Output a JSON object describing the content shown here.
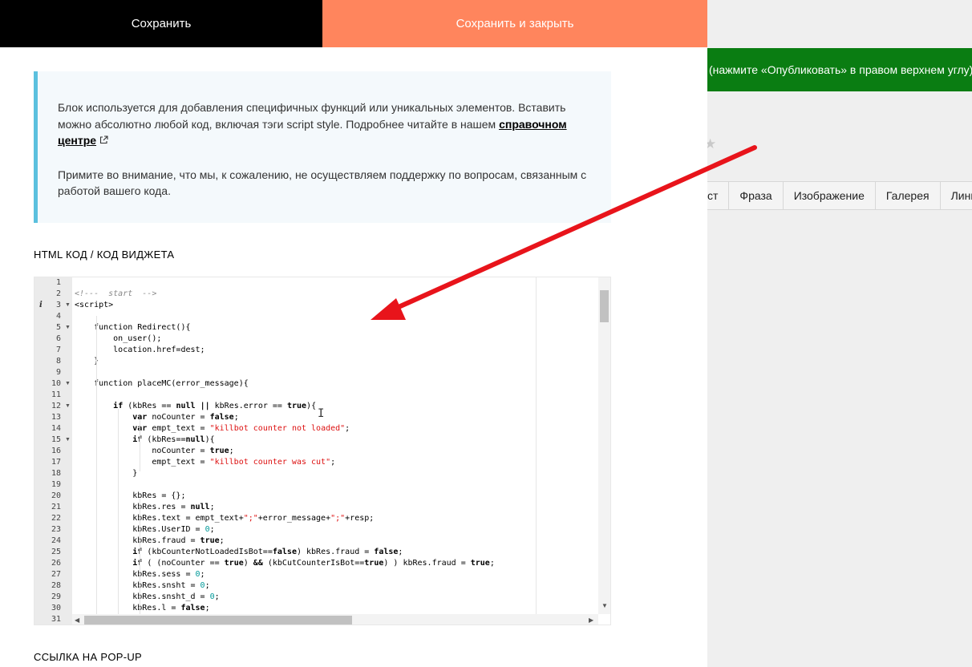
{
  "buttons": {
    "save": "Сохранить",
    "save_close": "Сохранить и закрыть"
  },
  "background": {
    "banner": "(нажмите «Опубликовать» в правом верхнем углу)",
    "toolbar": [
      "ст",
      "Фраза",
      "Изображение",
      "Галерея",
      "Линия"
    ]
  },
  "info": {
    "p1_text": "Блок используется для добавления специфичных функций или уникальных элементов. Вставить можно абсолютно любой код, включая тэги script style. Подробнее читайте в нашем ",
    "p1_link": "справочном центре",
    "p2": "Примите во внимание, что мы, к сожалению, не осуществляем поддержку по вопросам, связанным с работой вашего кода."
  },
  "section_html_title": "HTML КОД / КОД ВИДЖЕТА",
  "section_popup_title": "ССЫЛКА НА POP-UP",
  "colors": {
    "save": "#000000",
    "save_close": "#ff855d",
    "banner": "#0a7d12",
    "info_border": "#5bc0de",
    "arrow": "#e8141b"
  },
  "code_lines": [
    [],
    [
      [
        "c",
        "<!---  start  -->"
      ]
    ],
    [
      [
        "p",
        "<script>"
      ]
    ],
    [],
    [
      [
        "p",
        "    function Redirect(){"
      ]
    ],
    [
      [
        "p",
        "        on_user();"
      ]
    ],
    [
      [
        "p",
        "        location.href=dest;"
      ]
    ],
    [
      [
        "p",
        "    }"
      ]
    ],
    [],
    [
      [
        "p",
        "    function placeMC(error_message){"
      ]
    ],
    [],
    [
      [
        "p",
        "        "
      ],
      [
        "k",
        "if"
      ],
      [
        "p",
        " (kbRes == "
      ],
      [
        "k",
        "null"
      ],
      [
        "p",
        " "
      ],
      [
        "k",
        "||"
      ],
      [
        "p",
        " kbRes.error == "
      ],
      [
        "k",
        "true"
      ],
      [
        "p",
        "){"
      ]
    ],
    [
      [
        "p",
        "            "
      ],
      [
        "k",
        "var"
      ],
      [
        "p",
        " noCounter = "
      ],
      [
        "k",
        "false"
      ],
      [
        "p",
        ";"
      ]
    ],
    [
      [
        "p",
        "            "
      ],
      [
        "k",
        "var"
      ],
      [
        "p",
        " empt_text = "
      ],
      [
        "s",
        "\"killbot counter not loaded\""
      ],
      [
        "p",
        ";"
      ]
    ],
    [
      [
        "p",
        "            "
      ],
      [
        "k",
        "if"
      ],
      [
        "p",
        " (kbRes=="
      ],
      [
        "k",
        "null"
      ],
      [
        "p",
        "){"
      ]
    ],
    [
      [
        "p",
        "                noCounter = "
      ],
      [
        "k",
        "true"
      ],
      [
        "p",
        ";"
      ]
    ],
    [
      [
        "p",
        "                empt_text = "
      ],
      [
        "s",
        "\"killbot counter was cut\""
      ],
      [
        "p",
        ";"
      ]
    ],
    [
      [
        "p",
        "            }"
      ]
    ],
    [],
    [
      [
        "p",
        "            kbRes = {};"
      ]
    ],
    [
      [
        "p",
        "            kbRes.res = "
      ],
      [
        "k",
        "null"
      ],
      [
        "p",
        ";"
      ]
    ],
    [
      [
        "p",
        "            kbRes.text = empt_text+"
      ],
      [
        "s",
        "\";\""
      ],
      [
        "p",
        "+error_message+"
      ],
      [
        "s",
        "\";\""
      ],
      [
        "p",
        "+resp;"
      ]
    ],
    [
      [
        "p",
        "            kbRes.UserID = "
      ],
      [
        "n",
        "0"
      ],
      [
        "p",
        ";"
      ]
    ],
    [
      [
        "p",
        "            kbRes.fraud = "
      ],
      [
        "k",
        "true"
      ],
      [
        "p",
        ";"
      ]
    ],
    [
      [
        "p",
        "            "
      ],
      [
        "k",
        "if"
      ],
      [
        "p",
        " (kbCounterNotLoadedIsBot=="
      ],
      [
        "k",
        "false"
      ],
      [
        "p",
        ") kbRes.fraud = "
      ],
      [
        "k",
        "false"
      ],
      [
        "p",
        ";"
      ]
    ],
    [
      [
        "p",
        "            "
      ],
      [
        "k",
        "if"
      ],
      [
        "p",
        " ( (noCounter == "
      ],
      [
        "k",
        "true"
      ],
      [
        "p",
        ") "
      ],
      [
        "k",
        "&&"
      ],
      [
        "p",
        " (kbCutCounterIsBot=="
      ],
      [
        "k",
        "true"
      ],
      [
        "p",
        ") ) kbRes.fraud = "
      ],
      [
        "k",
        "true"
      ],
      [
        "p",
        ";"
      ]
    ],
    [
      [
        "p",
        "            kbRes.sess = "
      ],
      [
        "n",
        "0"
      ],
      [
        "p",
        ";"
      ]
    ],
    [
      [
        "p",
        "            kbRes.snsht = "
      ],
      [
        "n",
        "0"
      ],
      [
        "p",
        ";"
      ]
    ],
    [
      [
        "p",
        "            kbRes.snsht_d = "
      ],
      [
        "n",
        "0"
      ],
      [
        "p",
        ";"
      ]
    ],
    [
      [
        "p",
        "            kbRes.l = "
      ],
      [
        "k",
        "false"
      ],
      [
        "p",
        ";"
      ]
    ],
    []
  ],
  "fold_lines": [
    3,
    5,
    10,
    12,
    15
  ],
  "info_marker_line": 3
}
